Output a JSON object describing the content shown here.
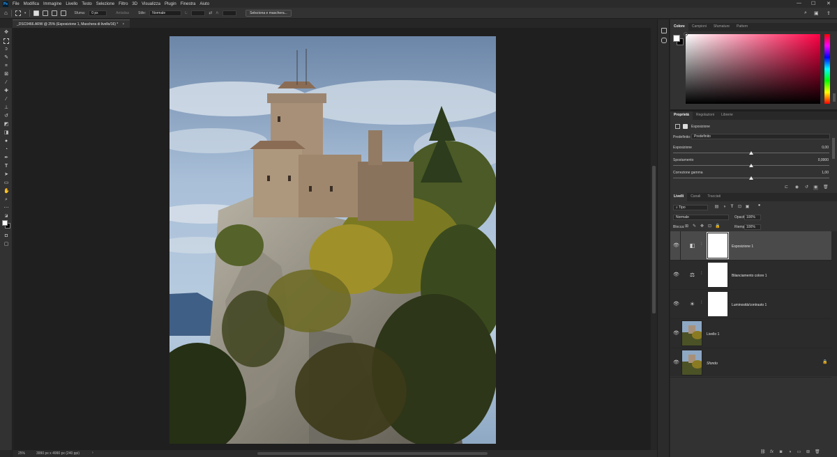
{
  "app": {
    "logo": "Ps"
  },
  "menu": [
    "File",
    "Modifica",
    "Immagine",
    "Livello",
    "Testo",
    "Selezione",
    "Filtro",
    "3D",
    "Visualizza",
    "Plugin",
    "Finestra",
    "Aiuto"
  ],
  "window_controls": {
    "minimize": "—",
    "maximize": "☐",
    "close": "✕"
  },
  "options_bar": {
    "sfuma_label": "Sfuma:",
    "sfuma_value": "0 px",
    "antialias_label": "Antialias",
    "stile_label": "Stile:",
    "stile_value": "Normale",
    "button": "Seleziona e maschera..."
  },
  "document_tab": {
    "title": "_DSC0466.ARW @ 25% (Esposizione 1, Maschera di livello/16) *",
    "close": "×"
  },
  "status": {
    "zoom": "25%",
    "doc_info": "3990 px x 4990 px (240 ppi)",
    "arrow": "›"
  },
  "color_panel": {
    "tabs": [
      "Colore",
      "Campioni",
      "Sfumature",
      "Pattern"
    ],
    "active_tab": "Colore",
    "picker_hue": "#ff0044"
  },
  "properties_panel": {
    "tabs": [
      "Proprietà",
      "Regolazioni",
      "Librerie"
    ],
    "active_tab": "Proprietà",
    "subtitle": "Esposizione",
    "preset_label": "Predefinito:",
    "preset_value": "Predefinito",
    "params": [
      {
        "label": "Esposizione",
        "value": "0,00",
        "level": 0.5
      },
      {
        "label": "Spostamento",
        "value": "0,0000",
        "level": 0.5
      },
      {
        "label": "Correzione gamma",
        "value": "1,00",
        "level": 0.5
      }
    ]
  },
  "layers_panel": {
    "tabs": [
      "Livelli",
      "Canali",
      "Tracciati"
    ],
    "active_tab": "Livelli",
    "filter_value": "Tipo",
    "blend_mode": "Normale",
    "opacity_label": "Opacità:",
    "opacity_value": "100%",
    "lock_label": "Blocca:",
    "fill_label": "Riemp.:",
    "fill_value": "100%",
    "layers": [
      {
        "name": "Esposizione 1",
        "kind": "adjustment",
        "icon": "exposure-icon",
        "glyph": "◧",
        "selected": true
      },
      {
        "name": "Bilanciamento colore 1",
        "kind": "adjustment",
        "icon": "color-balance-icon",
        "glyph": "⚖",
        "selected": false
      },
      {
        "name": "Luminosità/contrasto 1",
        "kind": "adjustment",
        "icon": "brightness-icon",
        "glyph": "☀",
        "selected": false
      },
      {
        "name": "Livello 1",
        "kind": "pixel",
        "selected": false
      },
      {
        "name": "Sfondo",
        "kind": "background",
        "locked": true,
        "selected": false
      }
    ]
  },
  "icons": {
    "eye": "👁",
    "chain": "⛓",
    "lock": "🔒"
  }
}
